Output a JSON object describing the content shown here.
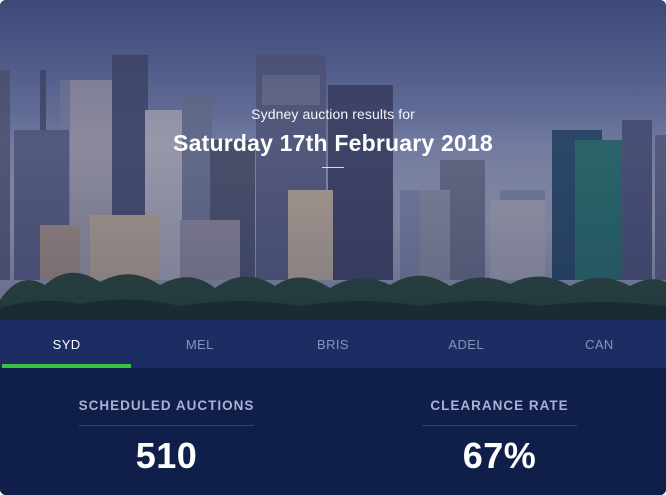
{
  "hero": {
    "subtitle": "Sydney auction results for",
    "title": "Saturday 17th February 2018"
  },
  "tabs": [
    {
      "label": "SYD",
      "active": true
    },
    {
      "label": "MEL",
      "active": false
    },
    {
      "label": "BRIS",
      "active": false
    },
    {
      "label": "ADEL",
      "active": false
    },
    {
      "label": "CAN",
      "active": false
    }
  ],
  "stats": {
    "scheduled": {
      "label": "SCHEDULED AUCTIONS",
      "value": "510"
    },
    "clearance": {
      "label": "CLEARANCE RATE",
      "value": "67%"
    }
  },
  "colors": {
    "tab_bar": "#1b2d63",
    "stats_bg": "#0f1f4a",
    "active_indicator": "#3cc23c"
  }
}
